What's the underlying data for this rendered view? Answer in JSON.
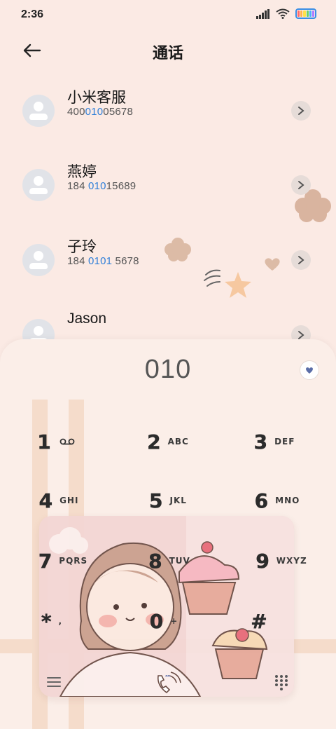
{
  "status": {
    "time": "2:36",
    "battery_colors": [
      "#ff6b6b",
      "#ffb44a",
      "#ffe14a",
      "#6ad06a",
      "#4ab0ff",
      "#b07bff"
    ]
  },
  "header": {
    "title": "通话",
    "back_icon": "arrow-left-icon"
  },
  "contacts": [
    {
      "name": "小米客服",
      "num_pre": "400",
      "num_hl": "010",
      "num_post": "05678"
    },
    {
      "name": "燕婷",
      "num_pre": "184 ",
      "num_hl": "010",
      "num_post": "15689"
    },
    {
      "name": "子玲",
      "num_pre": "184 ",
      "num_hl": "0101",
      "num_post": " 5678"
    },
    {
      "name": "Jason",
      "num_pre": "",
      "num_hl": "",
      "num_post": ""
    }
  ],
  "dialer": {
    "number": "010",
    "keys": [
      {
        "digit": "1",
        "letters": ""
      },
      {
        "digit": "2",
        "letters": "ABC"
      },
      {
        "digit": "3",
        "letters": "DEF"
      },
      {
        "digit": "4",
        "letters": "GHI"
      },
      {
        "digit": "5",
        "letters": "JKL"
      },
      {
        "digit": "6",
        "letters": "MNO"
      },
      {
        "digit": "7",
        "letters": "PQRS"
      },
      {
        "digit": "8",
        "letters": "TUV"
      },
      {
        "digit": "9",
        "letters": "WXYZ"
      },
      {
        "digit": "*",
        "letters": ","
      },
      {
        "digit": "0",
        "letters": "+"
      },
      {
        "digit": "#",
        "letters": ""
      }
    ]
  }
}
